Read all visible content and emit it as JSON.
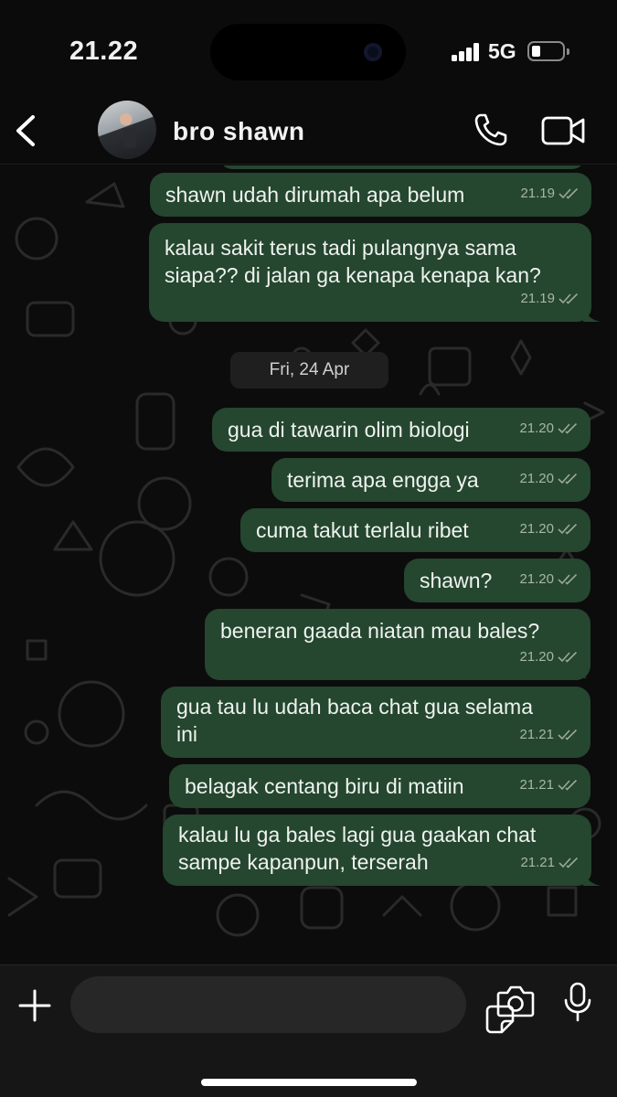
{
  "status": {
    "time": "21.22",
    "network": "5G"
  },
  "header": {
    "contact_name": "bro shawn"
  },
  "date_separator": "Fri, 24 Apr",
  "messages": [
    {
      "text": "shawn udah dirumah apa belum",
      "time": "21.19"
    },
    {
      "text": "kalau sakit terus tadi pulangnya sama\nsiapa?? di jalan ga kenapa kenapa kan?",
      "time": "21.19"
    },
    {
      "text": "gua di tawarin olim biologi",
      "time": "21.20"
    },
    {
      "text": "terima apa engga ya",
      "time": "21.20"
    },
    {
      "text": "cuma takut terlalu ribet",
      "time": "21.20"
    },
    {
      "text": "shawn?",
      "time": "21.20"
    },
    {
      "text": "beneran gaada niatan mau bales?",
      "time": "21.20"
    },
    {
      "text": "gua tau lu udah baca chat gua selama\nini",
      "time": "21.21"
    },
    {
      "text": "belagak centang biru di matiin",
      "time": "21.21"
    },
    {
      "text": "kalau lu ga bales lagi gua gaakan chat\nsampe kapanpun, terserah",
      "time": "21.21"
    }
  ],
  "input": {
    "placeholder": ""
  },
  "colors": {
    "bubble": "#25462f",
    "background": "#0c0c0c",
    "ticks": "#9aa89b"
  },
  "icons": [
    "back-chevron-icon",
    "phone-icon",
    "video-camera-icon",
    "plus-icon",
    "sticker-icon",
    "camera-icon",
    "microphone-icon"
  ]
}
